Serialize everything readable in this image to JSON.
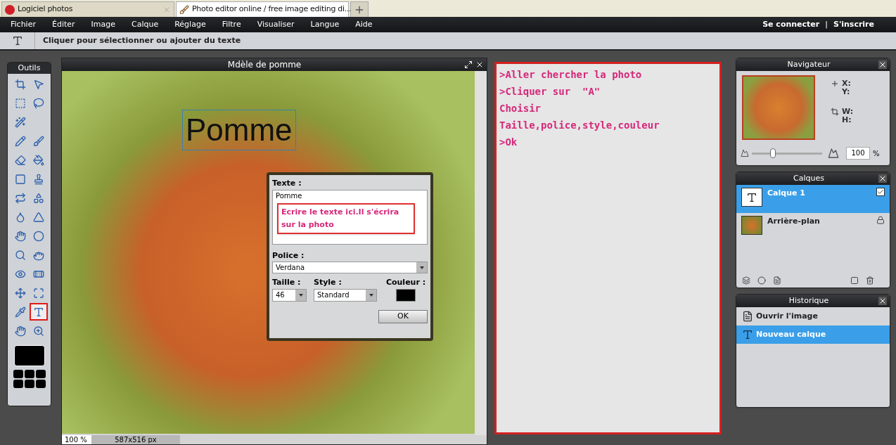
{
  "browser_tabs": [
    {
      "title": "Logiciel photos",
      "selected": false
    },
    {
      "title": "Photo editor online / free image editing di...",
      "selected": true
    }
  ],
  "menu": [
    "Fichier",
    "Éditer",
    "Image",
    "Calque",
    "Réglage",
    "Filtre",
    "Visualiser",
    "Langue",
    "Aide"
  ],
  "account": {
    "login": "Se connecter",
    "separator": "|",
    "signup": "S'inscrire"
  },
  "options_bar": {
    "hint": "Cliquer pour sélectionner ou ajouter du texte"
  },
  "tools_panel": {
    "title": "Outils",
    "tools": [
      {
        "selected": false
      },
      {
        "selected": false
      },
      {
        "selected": false
      },
      {
        "selected": false
      },
      {
        "selected": false
      },
      {
        "selected": false
      },
      {
        "selected": false
      },
      {
        "selected": false
      },
      {
        "selected": false
      },
      {
        "selected": false
      },
      {
        "selected": false
      },
      {
        "selected": false
      },
      {
        "selected": false
      },
      {
        "selected": false
      },
      {
        "selected": false
      },
      {
        "selected": false
      },
      {
        "selected": false
      },
      {
        "selected": false
      },
      {
        "selected": false
      },
      {
        "selected": false
      },
      {
        "selected": false
      },
      {
        "selected": false
      },
      {
        "selected": false
      },
      {
        "selected": false
      },
      {
        "selected": true
      },
      {
        "selected": false
      },
      {
        "selected": false
      }
    ]
  },
  "image_window": {
    "title": "Mdèle de pomme",
    "canvas_text": "Pomme",
    "zoom": "100 %",
    "size": "587x516 px"
  },
  "text_dialog": {
    "text_label": "Texte :",
    "text_value": "Pomme",
    "note": "Ecrire le texte ici.Il s'écrira sur la photo",
    "font_label": "Police :",
    "font_value": "Verdana",
    "size_label": "Taille :",
    "size_value": "46",
    "style_label": "Style :",
    "style_value": "Standard",
    "color_label": "Couleur :",
    "color": "#000000",
    "ok": "OK"
  },
  "instructions": [
    ">Aller chercher la photo",
    ">Cliquer sur  \"A\"",
    "Choisir",
    "Taille,police,style,couleur",
    ">Ok"
  ],
  "navigator": {
    "title": "Navigateur",
    "x_label": "X:",
    "y_label": "Y:",
    "w_label": "W:",
    "h_label": "H:",
    "level": 0.3,
    "zoom_value": "100",
    "percent": "%"
  },
  "layers": {
    "title": "Calques",
    "items": [
      {
        "kind": "text",
        "name": "Calque 1",
        "selected": true,
        "visible": true
      },
      {
        "kind": "photo",
        "name": "Arrière-plan",
        "selected": false,
        "locked": true
      }
    ]
  },
  "history": {
    "title": "Historique",
    "items": [
      {
        "kind": "open",
        "label": "Ouvrir l'image",
        "selected": false
      },
      {
        "kind": "text",
        "label": "Nouveau calque",
        "selected": true
      }
    ]
  }
}
